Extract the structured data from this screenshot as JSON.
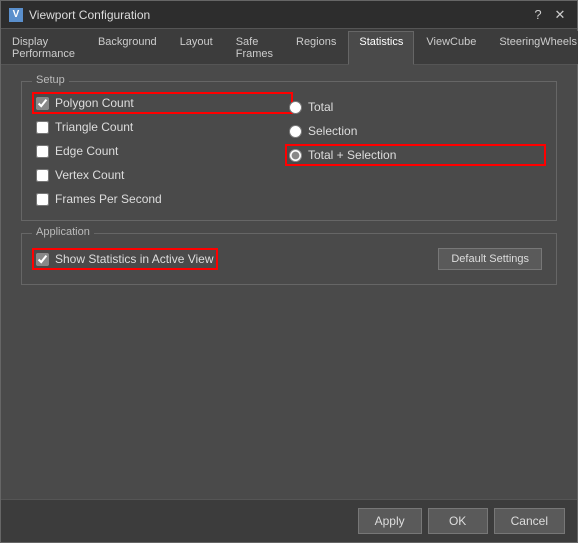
{
  "window": {
    "title": "Viewport Configuration",
    "icon": "V"
  },
  "tabs": [
    {
      "label": "Display Performance",
      "active": false
    },
    {
      "label": "Background",
      "active": false
    },
    {
      "label": "Layout",
      "active": false
    },
    {
      "label": "Safe Frames",
      "active": false
    },
    {
      "label": "Regions",
      "active": false
    },
    {
      "label": "Statistics",
      "active": true
    },
    {
      "label": "ViewCube",
      "active": false
    },
    {
      "label": "SteeringWheels",
      "active": false
    }
  ],
  "setup": {
    "label": "Setup",
    "checkboxes": [
      {
        "label": "Polygon Count",
        "checked": true,
        "highlighted": true
      },
      {
        "label": "Triangle Count",
        "checked": false,
        "highlighted": false
      },
      {
        "label": "Edge Count",
        "checked": false,
        "highlighted": false
      },
      {
        "label": "Vertex Count",
        "checked": false,
        "highlighted": false
      },
      {
        "label": "Frames Per Second",
        "checked": false,
        "highlighted": false
      }
    ],
    "radios": [
      {
        "label": "Total",
        "checked": false
      },
      {
        "label": "Selection",
        "checked": false
      },
      {
        "label": "Total + Selection",
        "checked": true,
        "highlighted": true
      }
    ]
  },
  "application": {
    "label": "Application",
    "show_statistics_label": "Show Statistics in Active View",
    "show_statistics_checked": true,
    "default_btn_label": "Default Settings"
  },
  "buttons": {
    "apply": "Apply",
    "ok": "OK",
    "cancel": "Cancel"
  },
  "title_controls": {
    "help": "?",
    "close": "✕"
  }
}
